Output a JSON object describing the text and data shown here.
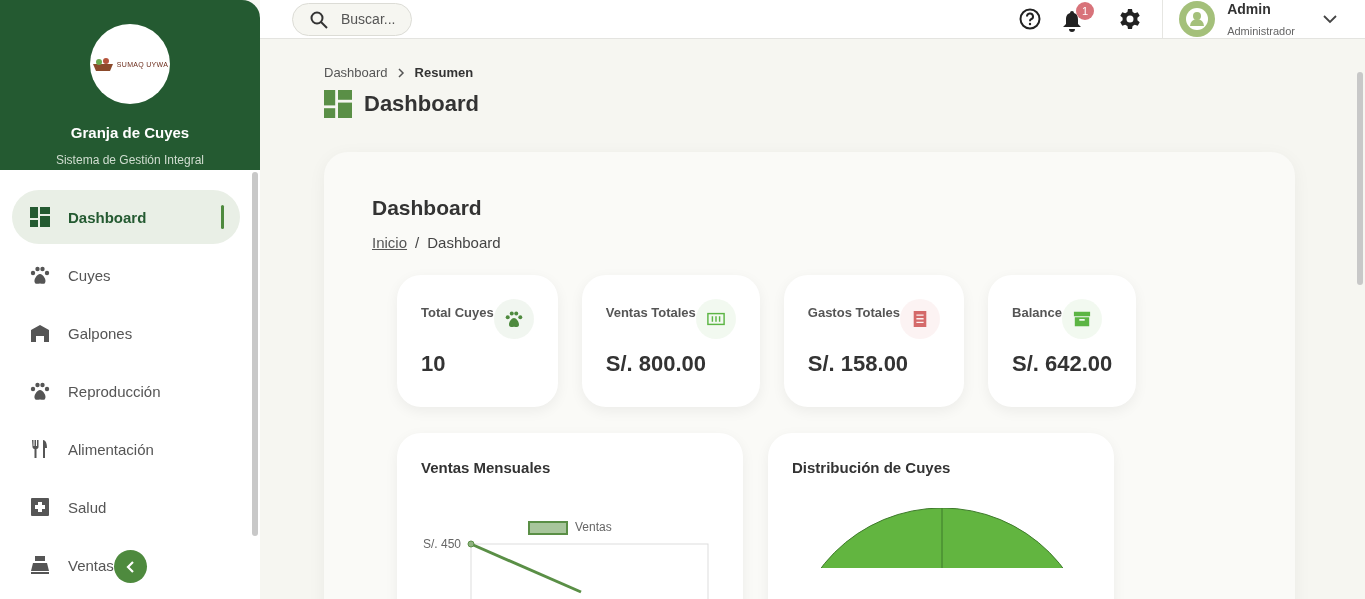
{
  "sidebar": {
    "logo_text": "SUMAQ UYWA",
    "title": "Granja de Cuyes",
    "subtitle": "Sistema de Gestión Integral",
    "items": [
      {
        "label": "Dashboard",
        "kind": "dashboard",
        "selected": true
      },
      {
        "label": "Cuyes",
        "kind": "paw",
        "selected": false
      },
      {
        "label": "Galpones",
        "kind": "barn",
        "selected": false
      },
      {
        "label": "Reproducción",
        "kind": "paw",
        "selected": false
      },
      {
        "label": "Alimentación",
        "kind": "utensils",
        "selected": false
      },
      {
        "label": "Salud",
        "kind": "medical",
        "selected": false
      },
      {
        "label": "Ventas",
        "kind": "register",
        "selected": false
      }
    ]
  },
  "topbar": {
    "search": {
      "placeholder": "Buscar..."
    },
    "notifications": "1",
    "user": {
      "name": "Admin",
      "role": "Administrador"
    }
  },
  "page": {
    "breadcrumb": [
      "Dashboard",
      "Resumen"
    ],
    "title": "Dashboard"
  },
  "content": {
    "title": "Dashboard",
    "breadcrumb": {
      "link": "Inicio",
      "separator": "/",
      "current": "Dashboard"
    },
    "stats": [
      {
        "label": "Total Cuyes",
        "value": "10",
        "kind": "paw",
        "color": "#4e8a3e"
      },
      {
        "label": "Ventas Totales",
        "value": "S/. 800.00",
        "kind": "money",
        "color": "#5cb544"
      },
      {
        "label": "Gastos Totales",
        "value": "S/. 158.00",
        "kind": "receipt",
        "color": "#d46a6a"
      },
      {
        "label": "Balance",
        "value": "S/. 642.00",
        "kind": "box",
        "color": "#5cb544"
      }
    ],
    "charts": [
      {
        "kind": "line",
        "title": "Ventas Mensuales",
        "legend": "Ventas",
        "tick_label": "S/. 450"
      },
      {
        "kind": "pie",
        "title": "Distribución de Cuyes"
      }
    ]
  }
}
